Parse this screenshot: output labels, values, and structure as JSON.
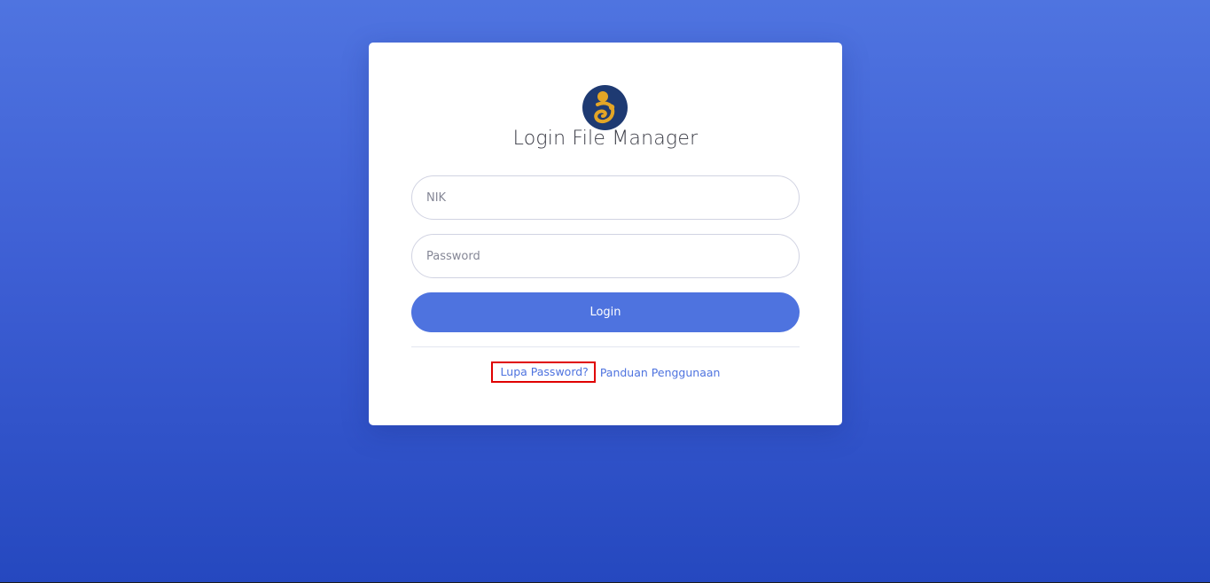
{
  "page": {
    "title": "Login File Manager"
  },
  "logo": {
    "icon": "mother-child-logo-icon",
    "colors": {
      "background": "#1e3a72",
      "figure": "#e3a526"
    }
  },
  "form": {
    "nik_placeholder": "NIK",
    "password_placeholder": "Password",
    "login_label": "Login"
  },
  "links": {
    "forgot_password": "Lupa Password?",
    "user_guide": "Panduan Penggunaan"
  },
  "colors": {
    "primary": "#4e73df",
    "highlight": "#e00000"
  }
}
